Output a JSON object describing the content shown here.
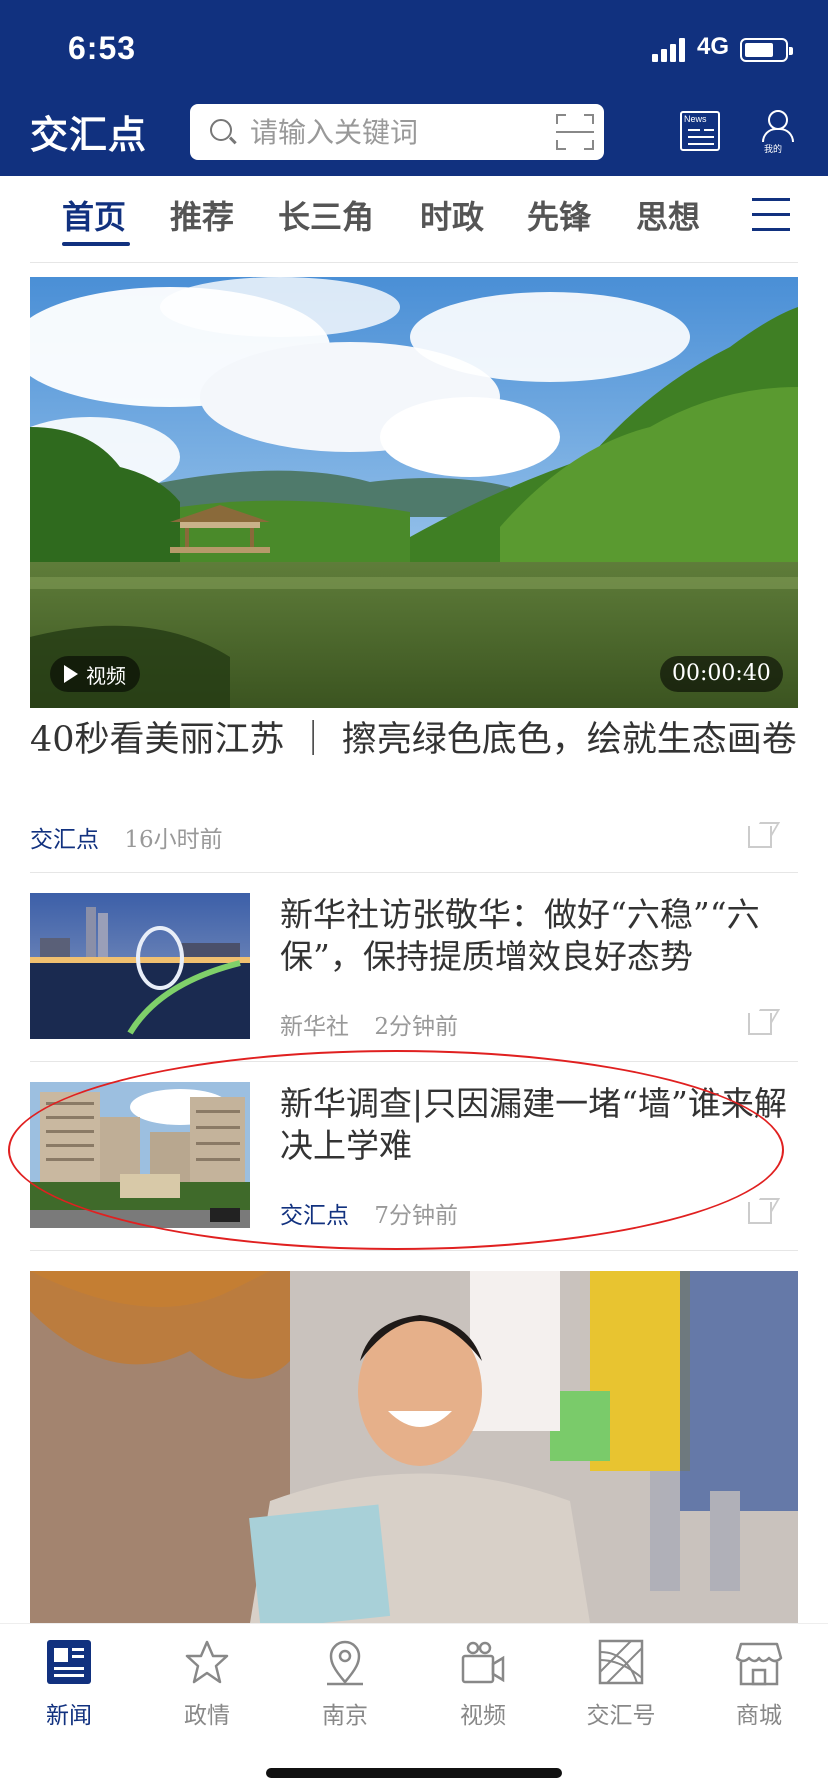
{
  "status_bar": {
    "time": "6:53",
    "network": "4G"
  },
  "header": {
    "logo": "交汇点",
    "search_placeholder": "请输入关键词",
    "news_icon_text": "News",
    "user_label": "我的"
  },
  "tabs": [
    {
      "label": "首页",
      "active": true
    },
    {
      "label": "推荐"
    },
    {
      "label": "长三角"
    },
    {
      "label": "时政"
    },
    {
      "label": "先锋"
    },
    {
      "label": "思想"
    }
  ],
  "feed": {
    "hero": {
      "badge": "视频",
      "duration": "00:00:40",
      "title": "40秒看美丽江苏 ｜ 擦亮绿色底色，绘就生态画卷",
      "source": "交汇点",
      "time": "16小时前"
    },
    "items": [
      {
        "title": "新华社访张敬华：做好“六稳”“六保”，保持提质增效良好态势",
        "source": "新华社",
        "time": "2分钟前"
      },
      {
        "title": "新华调查|只因漏建一堵“墙”谁来解决上学难",
        "source": "交汇点",
        "time": "7分钟前"
      }
    ]
  },
  "bottom_nav": [
    {
      "label": "新闻",
      "icon": "news-icon",
      "active": true
    },
    {
      "label": "政情",
      "icon": "star-icon"
    },
    {
      "label": "南京",
      "icon": "location-icon"
    },
    {
      "label": "视频",
      "icon": "video-camera-icon"
    },
    {
      "label": "交汇号",
      "icon": "interchange-icon"
    },
    {
      "label": "商城",
      "icon": "shop-icon"
    }
  ],
  "colors": {
    "brand": "#11317f",
    "annotation_circle": "#e02020"
  }
}
